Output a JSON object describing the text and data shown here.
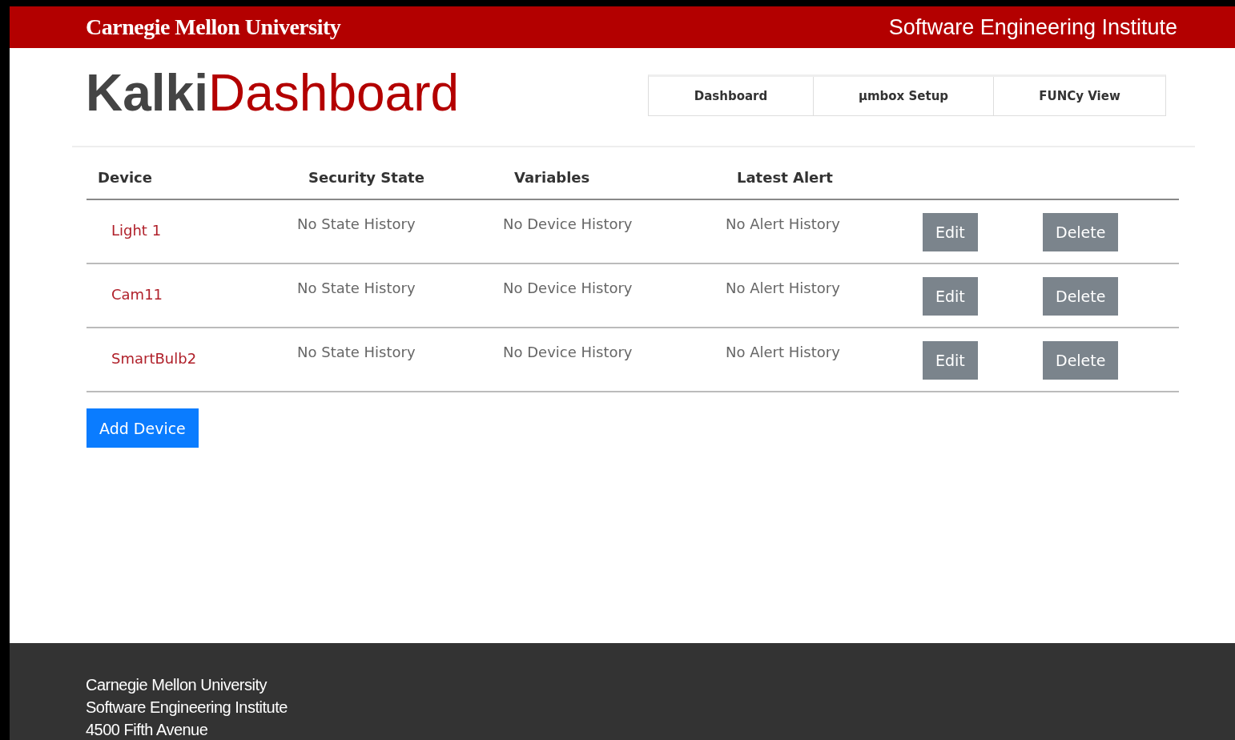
{
  "header": {
    "university": "Carnegie Mellon University",
    "institute": "Software Engineering Institute"
  },
  "title": {
    "first": "Kalki",
    "second": "Dashboard"
  },
  "nav": [
    {
      "label": "Dashboard",
      "selected": false
    },
    {
      "label": "µmbox Setup",
      "selected": false
    },
    {
      "label": "FUNCy View",
      "selected": false
    }
  ],
  "table": {
    "columns": [
      "Device",
      "Security State",
      "Variables",
      "Latest Alert"
    ],
    "rows": [
      {
        "device": "Light 1",
        "state": "No State History",
        "variables": "No Device History",
        "alert": "No Alert History",
        "edit": "Edit",
        "delete": "Delete"
      },
      {
        "device": "Cam11",
        "state": "No State History",
        "variables": "No Device History",
        "alert": "No Alert History",
        "edit": "Edit",
        "delete": "Delete"
      },
      {
        "device": "SmartBulb2",
        "state": "No State History",
        "variables": "No Device History",
        "alert": "No Alert History",
        "edit": "Edit",
        "delete": "Delete"
      }
    ]
  },
  "add_button": "Add Device",
  "footer": [
    "Carnegie Mellon University",
    "Software Engineering Institute",
    "4500 Fifth Avenue"
  ]
}
